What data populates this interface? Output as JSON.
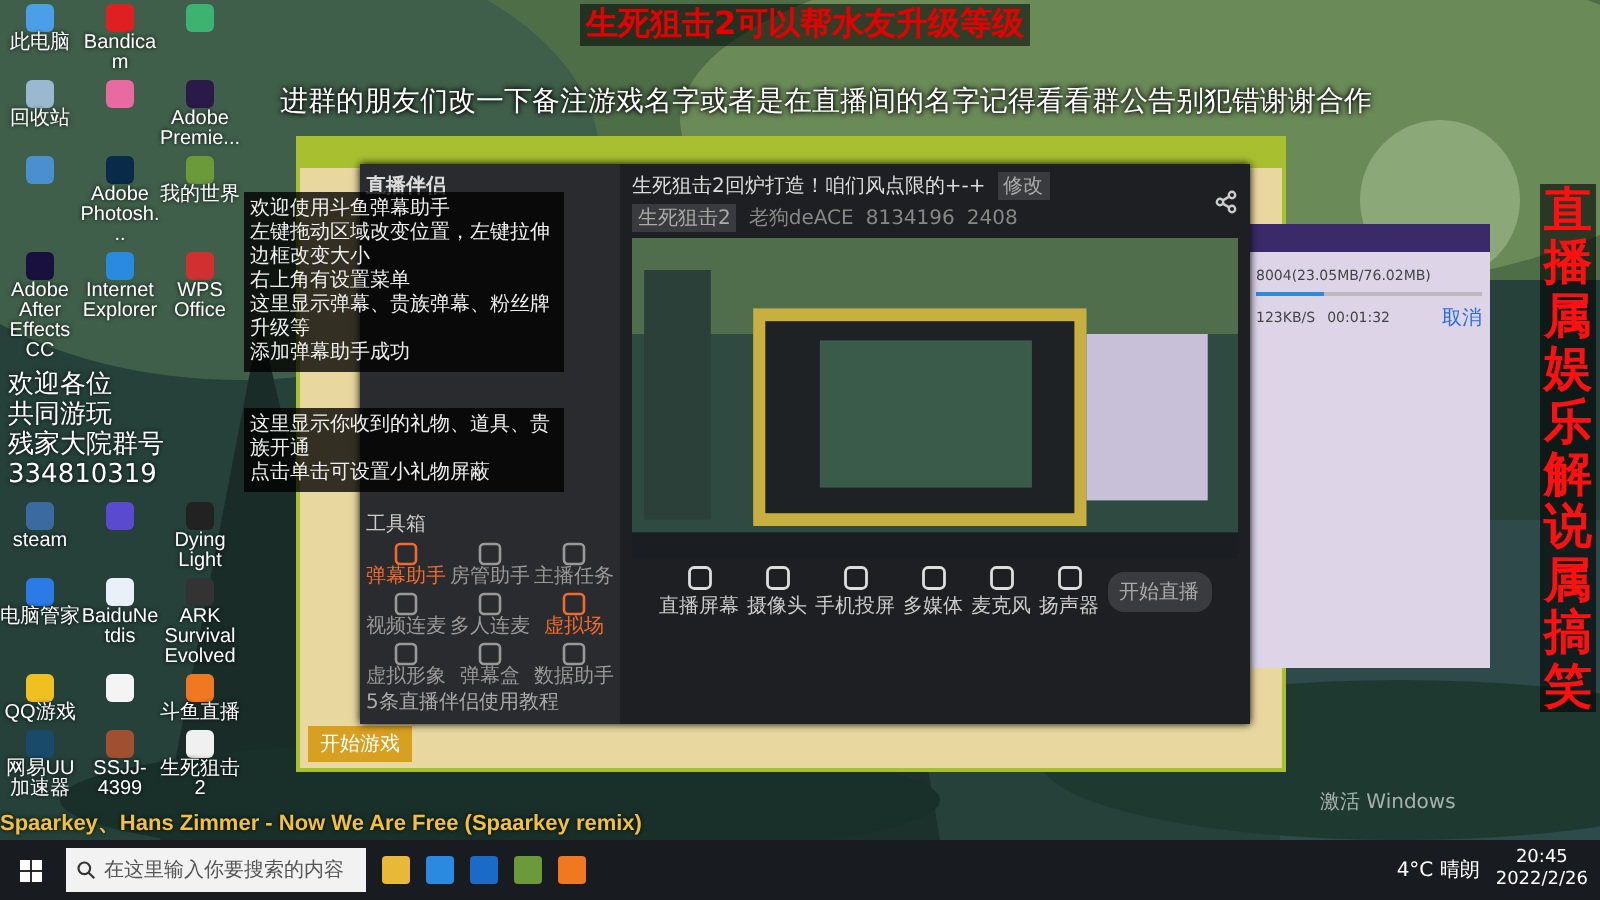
{
  "desktop_icons_top": [
    {
      "label": "此电脑",
      "color": "#4a9fe8"
    },
    {
      "label": "Bandicam",
      "color": "#e02020"
    },
    {
      "color": "#3cb371"
    },
    {
      "label": "回收站",
      "color": "#9ab8d0"
    },
    {
      "color": "#e86aa0"
    },
    {
      "label": "Adobe Premie...",
      "color": "#2a1a4a"
    },
    {
      "color": "#4a90d0"
    },
    {
      "label": "Adobe Photosh...",
      "color": "#0a2a4a"
    },
    {
      "label": "我的世界",
      "color": "#6a9a3a"
    },
    {
      "label": "Adobe After Effects CC",
      "color": "#1a1040"
    },
    {
      "label": "Internet Explorer",
      "color": "#2a8ae0"
    },
    {
      "label": "WPS Office",
      "color": "#d03030"
    }
  ],
  "welcome": [
    "欢迎各位",
    "共同游玩",
    "残家大院群号",
    "334810319"
  ],
  "desktop_icons_bottom": [
    {
      "label": "steam",
      "color": "#3a6aa0"
    },
    {
      "color": "#5a4ad0"
    },
    {
      "label": "Dying Light",
      "color": "#222222"
    },
    {
      "label": "电脑管家",
      "color": "#2a7ae8"
    },
    {
      "label": "BaiduNetdis",
      "color": "#e8f0f8"
    },
    {
      "label": "ARK Survival Evolved",
      "color": "#333333"
    },
    {
      "label": "QQ游戏",
      "color": "#f0c020"
    },
    {
      "color": "#f4f4f4"
    },
    {
      "label": "斗鱼直播",
      "color": "#f07820"
    },
    {
      "label": "网易UU加速器",
      "color": "#1a4a6a"
    },
    {
      "label": "SSJJ-4399",
      "color": "#a05030"
    },
    {
      "label": "生死狙击2",
      "color": "#f0f0f0"
    }
  ],
  "overlays": {
    "headline": "生死狙击2可以帮水友升级等级",
    "notice": "进群的朋友们改一下备注游戏名字或者是在直播间的名字记得看看群公告别犯错谢谢合作",
    "side_banner": "直播属娱乐解说属搞笑",
    "now_playing": "Spaarkey、Hans Zimmer - Now We Are Free (Spaarkey remix)"
  },
  "game_window": {
    "button": "开始游戏"
  },
  "stream_app": {
    "logo": "直播伴侣",
    "tips": [
      "欢迎使用斗鱼弹幕助手",
      "左键拖动区域改变位置，左键拉伸边框改变大小",
      "右上角有设置菜单",
      "这里显示弹幕、贵族弹幕、粉丝牌升级等",
      "添加弹幕助手成功"
    ],
    "gift_tips": [
      "这里显示你收到的礼物、道具、贵族开通",
      "点击单击可设置小礼物屏蔽"
    ],
    "toolbox_title": "工具箱",
    "tools": [
      {
        "label": "弹幕助手",
        "active": true
      },
      {
        "label": "房管助手",
        "active": false
      },
      {
        "label": "主播任务",
        "active": false
      },
      {
        "label": "视频连麦",
        "active": false
      },
      {
        "label": "多人连麦",
        "active": false
      },
      {
        "label": "虚拟场",
        "active": true
      },
      {
        "label": "虚拟形象",
        "active": false
      },
      {
        "label": "弹幕盒",
        "active": false
      },
      {
        "label": "数据助手",
        "active": false
      }
    ],
    "footer": "5条直播伴侣使用教程",
    "room_title": "生死狙击2回炉打造！咱们风点限的+-+",
    "edit": "修改",
    "category": "生死狙击2",
    "streamer": "老狗deACE",
    "room_id": "8134196",
    "viewers": "2408",
    "controls": [
      "直播屏幕",
      "摄像头",
      "手机投屏",
      "多媒体",
      "麦克风",
      "扬声器"
    ],
    "start": "开始直播"
  },
  "download_window": {
    "progress": "8004(23.05MB/76.02MB)",
    "speed": "123KB/S",
    "elapsed": "00:01:32",
    "cancel": "取消",
    "level": 0.3
  },
  "taskbar": {
    "search": "在这里输入你要搜索的内容",
    "weather": "4°C 晴朗",
    "time": "20:45",
    "date": "2022/2/26"
  },
  "activation": "激活 Windows"
}
